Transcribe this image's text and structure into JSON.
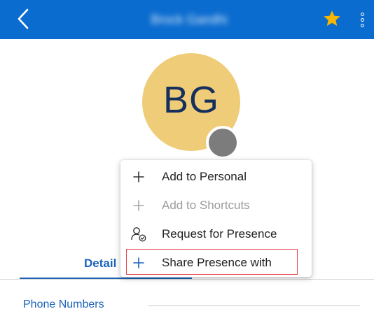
{
  "header": {
    "title": "Brock Gandhi",
    "back_icon": "chevron-left-icon",
    "favorite_icon": "star-icon",
    "more_icon": "more-vertical-icon",
    "background": "#0b6ccf",
    "star_color": "#f7b500"
  },
  "avatar": {
    "initials": "BG",
    "background": "#efcc78",
    "presence_color": "#7c7c7c"
  },
  "context_menu": {
    "items": [
      {
        "label": "Add to Personal",
        "icon": "plus-icon",
        "enabled": true
      },
      {
        "label": "Add to Shortcuts",
        "icon": "plus-icon",
        "enabled": false
      },
      {
        "label": "Request for Presence",
        "icon": "person-check-icon",
        "enabled": true
      },
      {
        "label": "Share Presence with",
        "icon": "plus-icon",
        "enabled": true,
        "highlighted": true
      }
    ]
  },
  "tabs": {
    "active_label": "Detail"
  },
  "sections": {
    "phone_numbers": "Phone Numbers"
  }
}
